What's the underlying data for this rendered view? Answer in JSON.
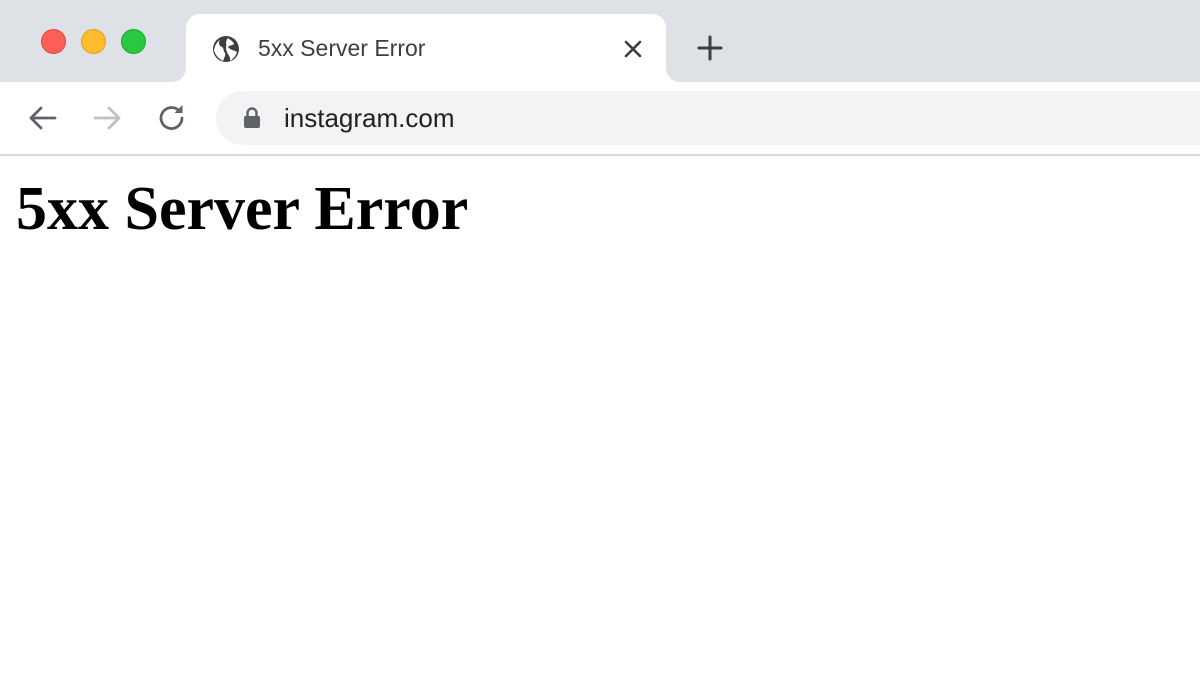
{
  "window": {
    "controls": {
      "close_color": "#ff5f57",
      "minimize_color": "#febc2e",
      "maximize_color": "#28c840"
    }
  },
  "tab": {
    "title": "5xx Server Error",
    "favicon": "globe-icon",
    "close_icon": "close-icon"
  },
  "toolbar": {
    "back_icon": "arrow-left-icon",
    "forward_icon": "arrow-right-icon",
    "reload_icon": "reload-icon",
    "new_tab_icon": "plus-icon",
    "address": {
      "security_icon": "lock-icon",
      "url": "instagram.com"
    }
  },
  "page": {
    "heading": "5xx Server Error"
  }
}
